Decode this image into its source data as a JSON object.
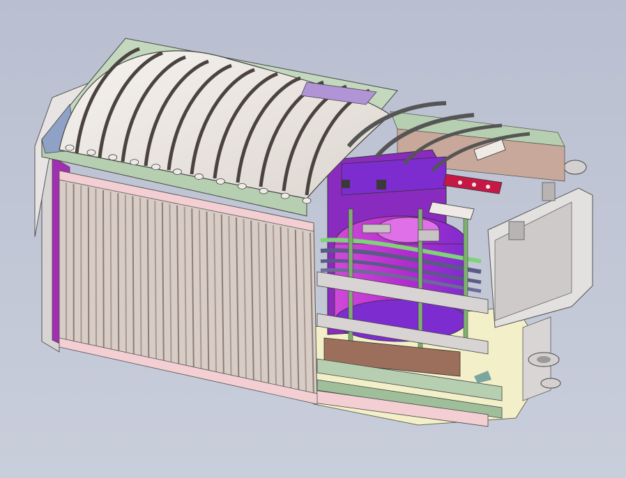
{
  "viewport": {
    "background_top": "#b9bfd0",
    "background_bottom": "#c9cedb"
  },
  "model": {
    "subject": "transformer-cad-assembly",
    "colors": {
      "radiator_fin": "#d8cdc6",
      "radiator_fin_dark": "#8c7d76",
      "tank_pink": "#f3cfd3",
      "rail_green": "#b7cfb1",
      "cover_white": "#efeae6",
      "core_magenta": "#b72ccf",
      "core_purple": "#7d2ccf",
      "winding_green": "#7fd27a",
      "winding_slate": "#5a5a86",
      "base_cream": "#f2efc9",
      "terminal_red": "#c61845",
      "clamp_gray": "#d8d4d4",
      "bracket_blue": "#8fa2c6",
      "hatch_violet": "#b094d6"
    }
  }
}
